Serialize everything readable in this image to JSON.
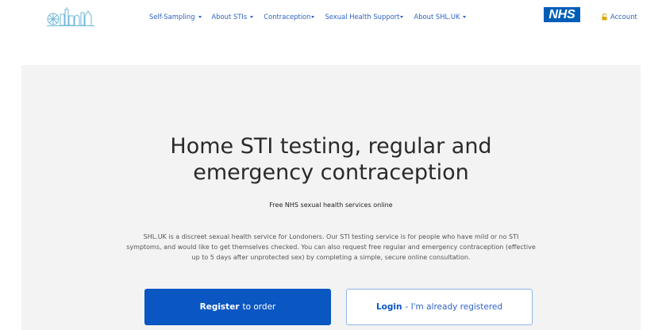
{
  "header": {
    "logo_icon": "london-skyline-logo",
    "nav": [
      {
        "label": "Self-Sampling",
        "has_dropdown": true
      },
      {
        "label": "About STIs",
        "has_dropdown": true
      },
      {
        "label": "Contraception",
        "has_dropdown": true
      },
      {
        "label": "Sexual Health Support",
        "has_dropdown": true
      },
      {
        "label": "About SHL.UK",
        "has_dropdown": true
      }
    ],
    "nhs_logo": "NHS",
    "account_label": "Account",
    "account_icon": "lock-icon"
  },
  "hero": {
    "title_line1": "Home STI testing, regular and",
    "title_line2": "emergency contraception",
    "subtitle": "Free NHS sexual health services online",
    "description_lines": [
      "SHL.UK is a discreet sexual health service for Londoners. Our STI testing service is for people who have mild or no STI",
      "symptoms, and would like to get themselves checked. You can also request free regular and emergency contraception (effective",
      "up to 5 days after unprotected sex) by completing a simple, secure online consultation."
    ],
    "register_button": {
      "bold": "Register",
      "rest": "to order"
    },
    "login_button": {
      "bold": "Login",
      "rest": "- I'm already registered"
    }
  },
  "colors": {
    "nav_link": "#2f62c4",
    "nhs_blue": "#005eb8",
    "primary_button": "#0a56c2",
    "hero_bg": "#f3f3f3"
  }
}
